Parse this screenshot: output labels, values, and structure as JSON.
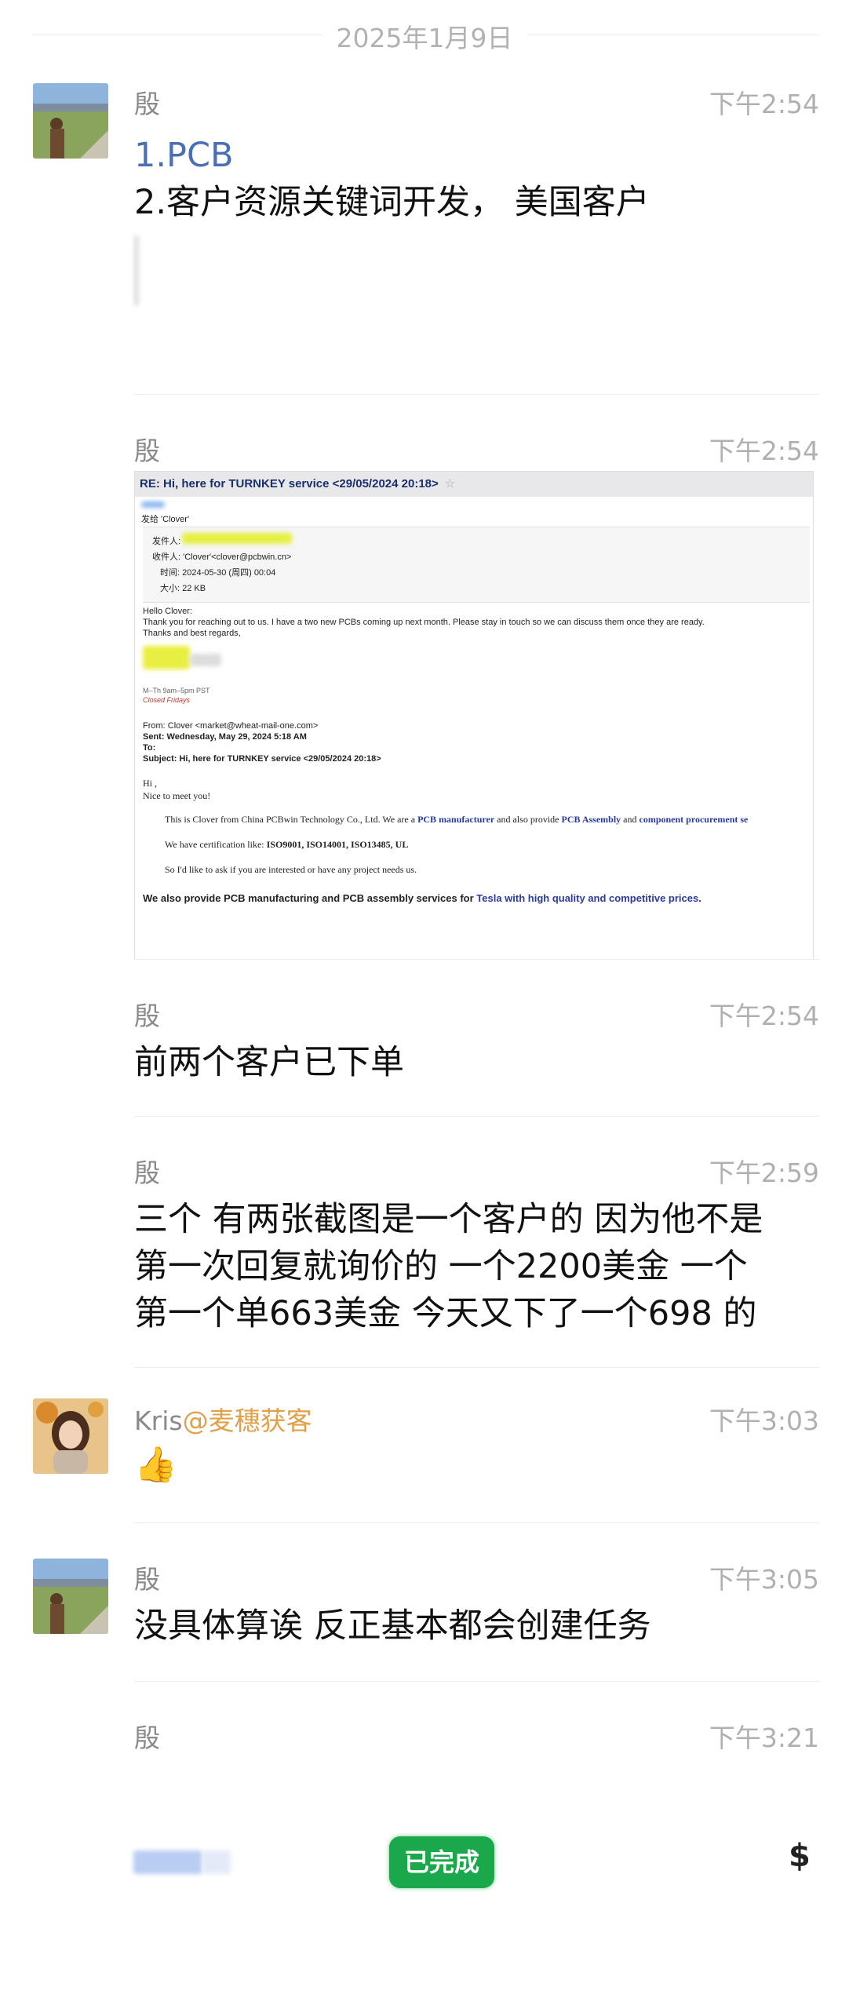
{
  "date_separator": "2025年1月9日",
  "messages": [
    {
      "sender": "殷",
      "time": "下午2:54",
      "line1": "1.PCB",
      "line2": "2.客户资源关键词开发， 美国客户"
    },
    {
      "sender": "殷",
      "time": "下午2:54"
    },
    {
      "sender": "殷",
      "time": "下午2:54",
      "text": "前两个客户已下单"
    },
    {
      "sender": "殷",
      "time": "下午2:59",
      "line1": "三个 有两张截图是一个客户的 因为他不是",
      "line2": "第一次回复就询价的 一个2200美金 一个",
      "line3": "第一个单663美金  今天又下了一个698 的"
    },
    {
      "sender_name": "Kris",
      "sender_group": "@麦穗获客",
      "time": "下午3:03",
      "emoji": "👍"
    },
    {
      "sender": "殷",
      "time": "下午3:05",
      "text": "没具体算诶 反正基本都会创建任务"
    },
    {
      "sender": "殷",
      "time": "下午3:21",
      "button": "已完成",
      "dollar": "$"
    }
  ],
  "email": {
    "subject_bar": "RE: Hi, here for TURNKEY service <29/05/2024 20:18>",
    "to_line": "发给 'Clover'",
    "from_label": "发件人:",
    "recipient": "收件人: 'Clover'<clover@pcbwin.cn>",
    "time": "时间: 2024-05-30 (周四) 00:04",
    "size": "大小: 22 KB",
    "greeting": "Hello Clover:",
    "reply": "Thank you for reaching out to us.  I have a two new PCBs coming up next month.  Please stay in touch so we can discuss them once they are ready.",
    "regards": "Thanks and best regards,",
    "hours": "M–Th 9am–5pm PST",
    "closed": "Closed Fridays",
    "q_from": "From: Clover <market@wheat-mail-one.com>",
    "q_sent": "Sent: Wednesday, May 29, 2024 5:18 AM",
    "q_to": "To:",
    "q_subject": "Subject: Hi, here for TURNKEY service <29/05/2024 20:18>",
    "q_hi": "Hi ,",
    "q_nice": "Nice to meet you!",
    "q_p1_a": "This is Clover from China PCBwin Technology Co., Ltd. We are a ",
    "q_p1_b": "PCB manufacturer",
    "q_p1_c": " and also provide ",
    "q_p1_d": "PCB Assembly",
    "q_p1_e": " and ",
    "q_p1_f": "component procurement se",
    "q_p2_a": "We have certification like: ",
    "q_p2_b": "ISO9001, ISO14001, ISO13485, UL",
    "q_p3": "So I'd like to ask if you are interested or have any project needs us.",
    "q_p4_a": "We also provide PCB manufacturing and PCB assembly services for ",
    "q_p4_b": "Tesla with high quality and competitive prices."
  },
  "colors": {
    "done_button": "#1aa84a",
    "group_name": "#e0a14a",
    "email_blue": "#2a3b9c"
  }
}
